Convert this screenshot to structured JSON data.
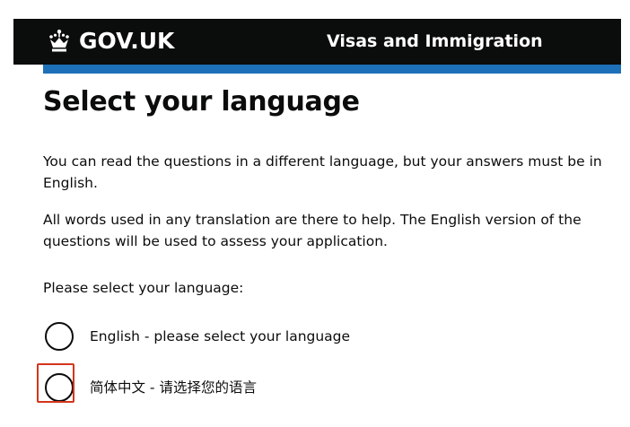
{
  "header": {
    "logo_text": "GOV.UK",
    "logo_icon": "crown-icon",
    "service_name": "Visas and Immigration",
    "background_color": "#0b0c0c",
    "rule_color": "#1d70b8"
  },
  "main": {
    "title": "Select your language",
    "paragraph_1": "You can read the questions in a different language, but your answers must be in English.",
    "paragraph_2": "All words used in any translation are there to help. The English version of the questions will be used to assess your application.",
    "prompt": "Please select your language:",
    "options": [
      {
        "label": "English - please select your language",
        "checked": false
      },
      {
        "label": "简体中文 - 请选择您的语言",
        "checked": false
      }
    ],
    "highlight_color": "#d4351c"
  }
}
